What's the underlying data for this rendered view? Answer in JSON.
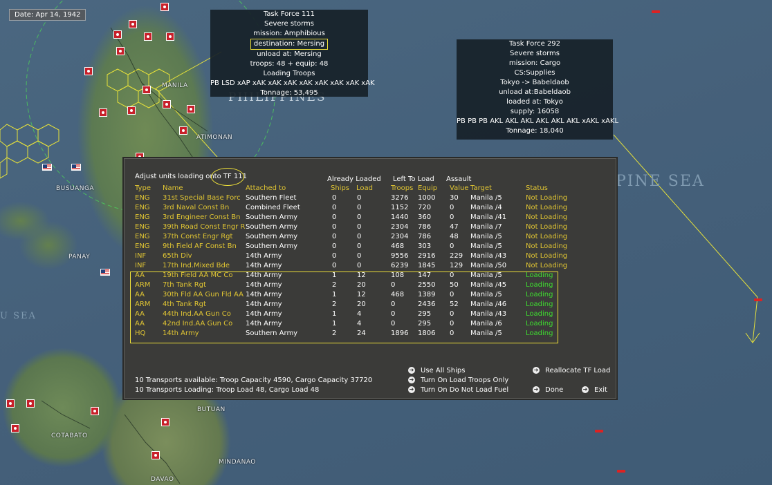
{
  "date": "Date: Apr 14, 1942",
  "map": {
    "labels": {
      "manila": "MANILA",
      "atimonan": "ATIMONAN",
      "busuanga": "BUSUANGA",
      "panay": "PANAY",
      "butuan": "BUTUAN",
      "cotabato": "COTABATO",
      "mindanao": "MINDANAO",
      "davao": "DAVAO",
      "philippines": "PHILIPPINES",
      "philippine_sea": "PINE SEA",
      "sulu_sea": "U SEA"
    }
  },
  "tf111": {
    "lines": [
      "Task Force 111",
      "Severe storms",
      "mission: Amphibious",
      "destination: Mersing",
      "unload at: Mersing",
      "troops: 48 + equip: 48",
      "Loading Troops",
      "PB LSD xAP xAK xAK xAK xAK xAK xAK xAK xAK",
      "Tonnage: 53,495"
    ]
  },
  "tf292": {
    "lines": [
      "Task Force 292",
      "Severe storms",
      "mission: Cargo",
      "CS:Supplies",
      "Tokyo -> Babeldaob",
      "unload at:Babeldaob",
      "loaded at: Tokyo",
      "supply: 16058",
      "PB PB PB AKL AKL AKL AKL AKL AKL xAKL xAKL",
      "Tonnage: 18,040"
    ]
  },
  "dialog": {
    "title": "Adjust units loading onto TF 111",
    "groups": {
      "already_loaded": "Already Loaded",
      "left_to_load": "Left To Load",
      "assault": "Assault"
    },
    "headers": {
      "type": "Type",
      "name": "Name",
      "attached": "Attached to",
      "ships": "Ships",
      "load": "Load",
      "troops": "Troops",
      "equip": "Equip",
      "value": "Value",
      "target": "Target",
      "status": "Status"
    },
    "rows": [
      {
        "type": "ENG",
        "name": "31st Special Base Forc",
        "attached": "Southern Fleet",
        "ships": "0",
        "load": "0",
        "troops": "3276",
        "equip": "1000",
        "value": "30",
        "target": "Manila /5",
        "status": "Not Loading"
      },
      {
        "type": "ENG",
        "name": "3rd Naval Const Bn",
        "attached": "Combined Fleet",
        "ships": "0",
        "load": "0",
        "troops": "1152",
        "equip": "720",
        "value": "0",
        "target": "Manila /4",
        "status": "Not Loading"
      },
      {
        "type": "ENG",
        "name": "3rd Engineer Const Bn",
        "attached": "Southern Army",
        "ships": "0",
        "load": "0",
        "troops": "1440",
        "equip": "360",
        "value": "0",
        "target": "Manila /41",
        "status": "Not Loading"
      },
      {
        "type": "ENG",
        "name": "39th Road Const Engr R",
        "attached": "Southern Army",
        "ships": "0",
        "load": "0",
        "troops": "2304",
        "equip": "786",
        "value": "47",
        "target": "Manila /7",
        "status": "Not Loading"
      },
      {
        "type": "ENG",
        "name": "37th Const Engr Rgt",
        "attached": "Southern Army",
        "ships": "0",
        "load": "0",
        "troops": "2304",
        "equip": "786",
        "value": "48",
        "target": "Manila /5",
        "status": "Not Loading"
      },
      {
        "type": "ENG",
        "name": "9th Field AF Const Bn",
        "attached": "Southern Army",
        "ships": "0",
        "load": "0",
        "troops": "468",
        "equip": "303",
        "value": "0",
        "target": "Manila /5",
        "status": "Not Loading"
      },
      {
        "type": "INF",
        "name": "65th Div",
        "attached": "14th Army",
        "ships": "0",
        "load": "0",
        "troops": "9556",
        "equip": "2916",
        "value": "229",
        "target": "Manila /43",
        "status": "Not Loading"
      },
      {
        "type": "INF",
        "name": "17th Ind.Mixed Bde",
        "attached": "14th Army",
        "ships": "0",
        "load": "0",
        "troops": "6239",
        "equip": "1845",
        "value": "129",
        "target": "Manila /50",
        "status": "Not Loading"
      },
      {
        "type": "AA",
        "name": "19th Field AA MC Co",
        "attached": "14th Army",
        "ships": "1",
        "load": "12",
        "troops": "108",
        "equip": "147",
        "value": "0",
        "target": "Manila /5",
        "status": "Loading"
      },
      {
        "type": "ARM",
        "name": "7th Tank Rgt",
        "attached": "14th Army",
        "ships": "2",
        "load": "20",
        "troops": "0",
        "equip": "2550",
        "value": "50",
        "target": "Manila /45",
        "status": "Loading"
      },
      {
        "type": "AA",
        "name": "30th Fld AA Gun Fld AA",
        "attached": "14th Army",
        "ships": "1",
        "load": "12",
        "troops": "468",
        "equip": "1389",
        "value": "0",
        "target": "Manila /5",
        "status": "Loading"
      },
      {
        "type": "ARM",
        "name": "4th Tank Rgt",
        "attached": "14th Army",
        "ships": "2",
        "load": "20",
        "troops": "0",
        "equip": "2436",
        "value": "52",
        "target": "Manila /46",
        "status": "Loading"
      },
      {
        "type": "AA",
        "name": "44th Ind.AA Gun Co",
        "attached": "14th Army",
        "ships": "1",
        "load": "4",
        "troops": "0",
        "equip": "295",
        "value": "0",
        "target": "Manila /43",
        "status": "Loading"
      },
      {
        "type": "AA",
        "name": "42nd Ind.AA Gun Co",
        "attached": "14th Army",
        "ships": "1",
        "load": "4",
        "troops": "0",
        "equip": "295",
        "value": "0",
        "target": "Manila /6",
        "status": "Loading"
      },
      {
        "type": "HQ",
        "name": "14th Army",
        "attached": "Southern Army",
        "ships": "2",
        "load": "24",
        "troops": "1896",
        "equip": "1806",
        "value": "0",
        "target": "Manila /5",
        "status": "Loading"
      }
    ],
    "footer": {
      "available": "10 Transports available:  Troop Capacity 4590, Cargo Capacity 37720",
      "loading": "10 Transports Loading:   Troop Load 48, Cargo Load 48"
    },
    "options": {
      "use_all": "Use All Ships",
      "load_troops": "Turn On Load Troops Only",
      "no_fuel": "Turn On Do Not Load Fuel",
      "reallocate": "Reallocate TF Load",
      "done": "Done",
      "exit": "Exit"
    }
  },
  "colors": {
    "header_yellow": "#e0c533",
    "loading_green": "#3fdc30",
    "highlight_yellow": "#f0e23a",
    "dialog_bg": "#3b3b39"
  }
}
